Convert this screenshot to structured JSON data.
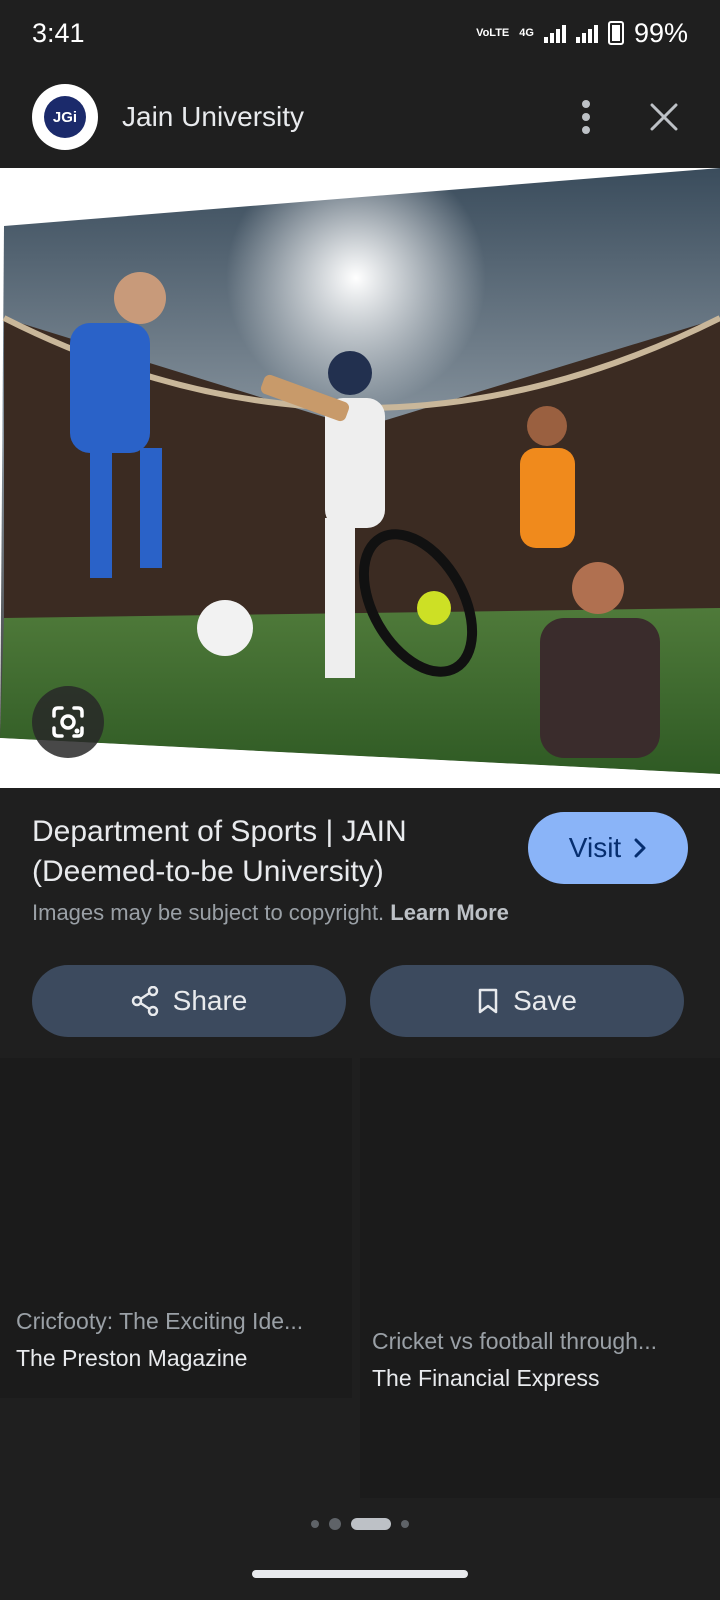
{
  "status": {
    "time": "3:41",
    "network_top": "VoLTE",
    "network_sub": "4G",
    "battery": "99%"
  },
  "header": {
    "site_name": "Jain University",
    "logo_text": "JGi"
  },
  "result": {
    "title": "Department of Sports | JAIN (Deemed-to-be University)",
    "visit_label": "Visit",
    "copyright_text": "Images may be subject to copyright.",
    "learn_more": "Learn More",
    "share_label": "Share",
    "save_label": "Save"
  },
  "related": [
    {
      "title": "Cricfooty: The Exciting Ide...",
      "source": "The Preston Magazine"
    },
    {
      "title": "Cricket vs football through...",
      "source": "The Financial Express"
    }
  ],
  "pager": {
    "count": 4,
    "active_index": 2
  },
  "colors": {
    "background": "#1f1f1f",
    "accent": "#8ab4f8",
    "button_bg": "#3c4a5e"
  }
}
